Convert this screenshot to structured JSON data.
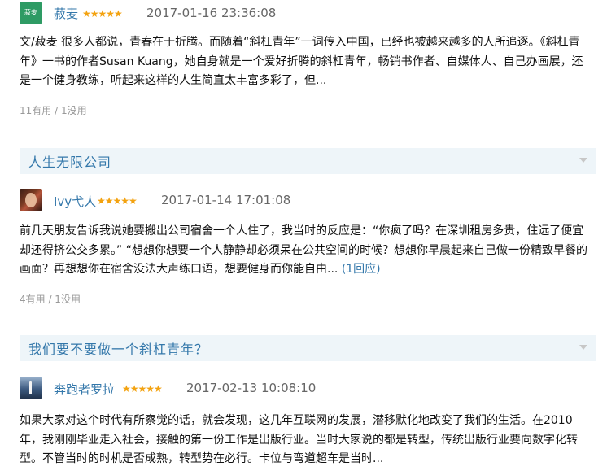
{
  "reviews": [
    {
      "user": "菽麦",
      "avatar_text": "菽麦",
      "avatar_color": "#2e9b64",
      "stars": "★★★★★",
      "rating": 5,
      "time": "2017-01-16 23:36:08",
      "body": "文/菽麦 很多人都说，青春在于折腾。而随着“斜杠青年”一词传入中国，已经也被越来越多的人所追逐。《斜杠青年》一书的作者Susan Kuang，她自身就是一个爱好折腾的斜杠青年，畅销书作者、自媒体人、自己办画展，还是一个健身教练，听起来这样的人生简直太丰富多彩了，但...",
      "votes": "11有用 / 1没用"
    },
    {
      "user": "Ivy弋人",
      "stars": "★★★★★",
      "rating": 5,
      "time": "2017-01-14 17:01:08",
      "body": "前几天朋友告诉我说她要搬出公司宿舍一个人住了，我当时的反应是：“你疯了吗？在深圳租房多贵，住远了便宜却还得挤公交多累。” “想想你想要一个人静静却必须呆在公共空间的时候？想想你早晨起来自己做一份精致早餐的画面？再想想你在宿舍没法大声练口语，想要健身而你能自由...",
      "reply": "(1回应)",
      "votes": "4有用 / 1没用"
    },
    {
      "user": "奔跑者罗拉",
      "stars": "★★★★★",
      "rating": 5,
      "time": "2017-02-13 10:08:10",
      "body": "如果大家对这个时代有所察觉的话，就会发现，这几年互联网的发展，潜移默化地改变了我们的生活。在2010年，我刚刚毕业走入社会，接触的第一份工作是出版行业。当时大家说的都是转型，传统出版行业要向数字化转型。不管当时的时机是否成熟，转型势在必行。卡位与弯道超车是当时..."
    }
  ],
  "section_titles": [
    "人生无限公司",
    "我们要不要做一个斜杠青年？"
  ]
}
